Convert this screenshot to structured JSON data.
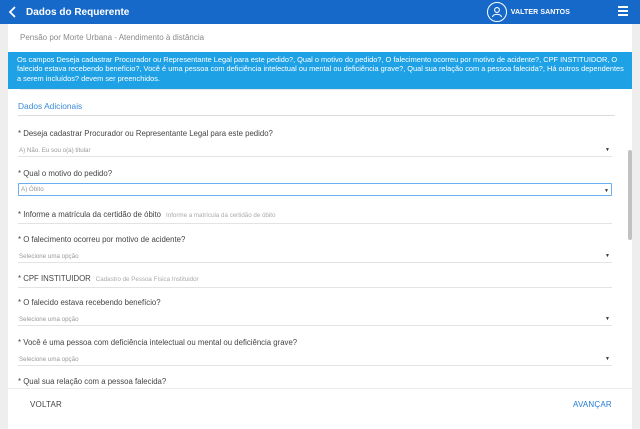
{
  "appbar": {
    "title": "Dados do Requerente",
    "user_name": "VALTER SANTOS"
  },
  "subtitle": "Pensão por Morte Urbana - Atendimento à distância",
  "banner": "Os campos Deseja cadastrar Procurador ou Representante Legal para este pedido?, Qual o motivo do pedido?, O falecimento ocorreu por motivo de acidente?, CPF INSTITUIDOR, O falecido estava recebendo benefício?, Você é uma pessoa com deficiência intelectual ou mental ou deficiência grave?, Qual sua relação com a pessoa falecida?, Há outros dependentes a serem incluídos? devem ser preenchidos.",
  "section_title": "Dados Adicionais",
  "fields": {
    "procurador": {
      "label": "* Deseja cadastrar Procurador ou Representante Legal para este pedido?",
      "value": "A) Não. Eu sou o(a) titular"
    },
    "motivo": {
      "label": "* Qual o motivo do pedido?",
      "value": "A) Óbito"
    },
    "matricula": {
      "label": "* Informe a matrícula da certidão de óbito",
      "placeholder": "Informe a matrícula da certidão de óbito"
    },
    "acidente": {
      "label": "* O falecimento ocorreu por motivo de acidente?",
      "value": "Selecione uma opção"
    },
    "cpf": {
      "label": "* CPF INSTITUIDOR",
      "placeholder": "Cadastro de Pessoa Física Instituidor"
    },
    "beneficio": {
      "label": "* O falecido estava recebendo benefício?",
      "value": "Selecione uma opção"
    },
    "deficiencia": {
      "label": "* Você é uma pessoa com deficiência intelectual ou mental ou deficiência grave?",
      "value": "Selecione uma opção"
    },
    "relacao": {
      "label": "* Qual sua relação com a pessoa falecida?"
    }
  },
  "caret_glyph": "▼",
  "footer": {
    "back": "VOLTAR",
    "next": "AVANÇAR"
  },
  "colors": {
    "appbar": "#1769c9",
    "banner": "#1fa1e6",
    "section": "#3c8ad8",
    "primary_link": "#1f7ad6"
  },
  "icons": [
    "back-arrow-icon",
    "user-avatar-icon",
    "menu-icon",
    "chevron-down-icon"
  ]
}
